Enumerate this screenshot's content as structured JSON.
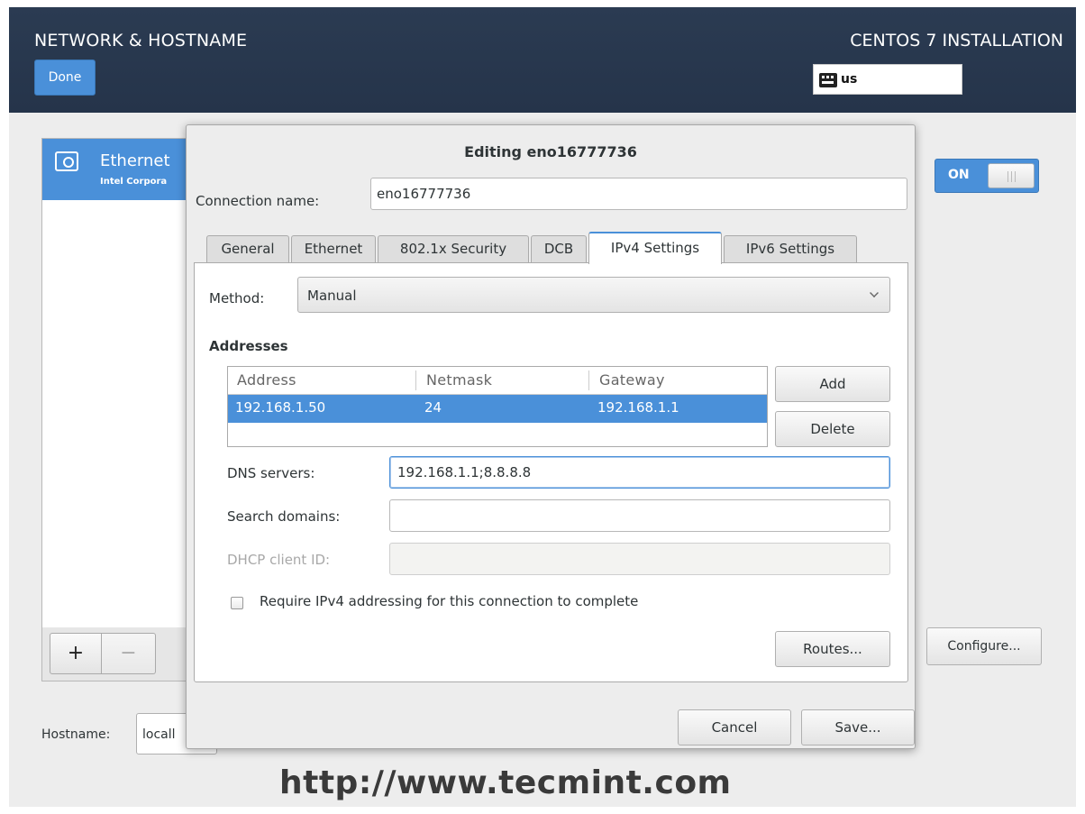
{
  "header": {
    "title": "NETWORK & HOSTNAME",
    "done_label": "Done",
    "install_title": "CENTOS 7 INSTALLATION",
    "keyboard_layout": "us",
    "keyboard_icon": "keyboard-icon"
  },
  "connections": {
    "items": [
      {
        "name": "Ethernet",
        "vendor": "Intel Corpora",
        "icon": "ethernet-icon",
        "selected": true
      }
    ],
    "add_label": "+",
    "remove_label": "−"
  },
  "hostname": {
    "label": "Hostname:",
    "value": "locall"
  },
  "device": {
    "toggle_label": "ON",
    "toggle_state": "on",
    "configure_label": "Configure..."
  },
  "watermark": "http://www.tecmint.com",
  "dialog": {
    "title": "Editing eno16777736",
    "connection_name_label": "Connection name:",
    "connection_name_value": "eno16777736",
    "tabs": [
      {
        "label": "General",
        "active": false
      },
      {
        "label": "Ethernet",
        "active": false
      },
      {
        "label": "802.1x Security",
        "active": false
      },
      {
        "label": "DCB",
        "active": false
      },
      {
        "label": "IPv4 Settings",
        "active": true
      },
      {
        "label": "IPv6 Settings",
        "active": false
      }
    ],
    "ipv4": {
      "method_label": "Method:",
      "method_value": "Manual",
      "addresses_heading": "Addresses",
      "columns": [
        "Address",
        "Netmask",
        "Gateway"
      ],
      "rows": [
        {
          "address": "192.168.1.50",
          "netmask": "24",
          "gateway": "192.168.1.1"
        }
      ],
      "add_label": "Add",
      "delete_label": "Delete",
      "dns_label": "DNS servers:",
      "dns_value": "192.168.1.1;8.8.8.8",
      "search_label": "Search domains:",
      "search_value": "",
      "dhcp_label": "DHCP client ID:",
      "dhcp_value": "",
      "require_label": "Require IPv4 addressing for this connection to complete",
      "require_checked": false,
      "routes_label": "Routes..."
    },
    "cancel_label": "Cancel",
    "save_label": "Save..."
  },
  "colors": {
    "accent": "#4a90d9",
    "header_bg": "#27364c",
    "window_bg": "#ededed"
  }
}
